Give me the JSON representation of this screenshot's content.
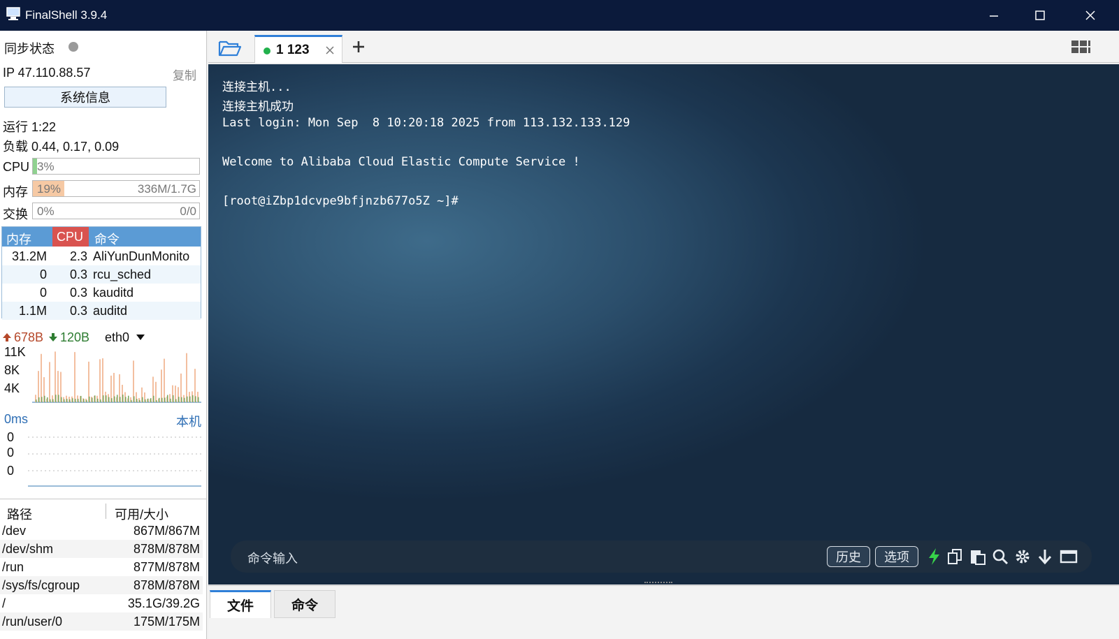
{
  "window": {
    "title": "FinalShell 3.9.4"
  },
  "left": {
    "sync_label": "同步状态",
    "ip": "IP 47.110.88.57",
    "copy_label": "复制",
    "sysinfo_label": "系统信息",
    "uptime": "运行 1:22",
    "load": "负载 0.44, 0.17, 0.09",
    "meters": [
      {
        "label": "CPU",
        "percent_text": "3%",
        "right_text": "",
        "fill": 0.03,
        "color": "#8fd18f"
      },
      {
        "label": "内存",
        "percent_text": "19%",
        "right_text": "336M/1.7G",
        "fill": 0.19,
        "color": "#f6c9a4"
      },
      {
        "label": "交换",
        "percent_text": "0%",
        "right_text": "0/0",
        "fill": 0.0,
        "color": "#cfe3f5"
      }
    ],
    "process_headers": {
      "mem": "内存",
      "cpu": "CPU",
      "cmd": "命令"
    },
    "processes": [
      {
        "mem": "31.2M",
        "cpu": "2.3",
        "cmd": "AliYunDunMonito"
      },
      {
        "mem": "0",
        "cpu": "0.3",
        "cmd": "rcu_sched"
      },
      {
        "mem": "0",
        "cpu": "0.3",
        "cmd": "kauditd"
      },
      {
        "mem": "1.1M",
        "cpu": "0.3",
        "cmd": "auditd"
      }
    ],
    "net": {
      "up": "678B",
      "down": "120B",
      "iface": "eth0",
      "y_labels": [
        "11K",
        "8K",
        "4K"
      ]
    },
    "ping": {
      "latency": "0ms",
      "host": "本机",
      "y_labels": [
        "0",
        "0",
        "0"
      ]
    },
    "disk_headers": {
      "path": "路径",
      "size": "可用/大小"
    },
    "disks": [
      {
        "path": "/dev",
        "size": "867M/867M"
      },
      {
        "path": "/dev/shm",
        "size": "878M/878M"
      },
      {
        "path": "/run",
        "size": "877M/878M"
      },
      {
        "path": "/sys/fs/cgroup",
        "size": "878M/878M"
      },
      {
        "path": "/",
        "size": "35.1G/39.2G"
      },
      {
        "path": "/run/user/0",
        "size": "175M/175M"
      }
    ]
  },
  "tabs": {
    "active_label": "1 123"
  },
  "terminal": {
    "lines": [
      "连接主机...",
      "连接主机成功",
      "Last login: Mon Sep  8 10:20:18 2025 from 113.132.133.129",
      "",
      "Welcome to Alibaba Cloud Elastic Compute Service !",
      "",
      "[root@iZbp1dcvpe9bfjnzb677o5Z ~]#"
    ],
    "command_placeholder": "命令输入",
    "history_label": "历史",
    "options_label": "选项"
  },
  "bottom_tabs": {
    "files": "文件",
    "commands": "命令"
  },
  "colors": {
    "titlebar": "#0b1a3b",
    "accent": "#2f7fd8",
    "status_green": "#22b14c",
    "cpu_header": "#d9534f",
    "table_header": "#5b9bd5"
  }
}
